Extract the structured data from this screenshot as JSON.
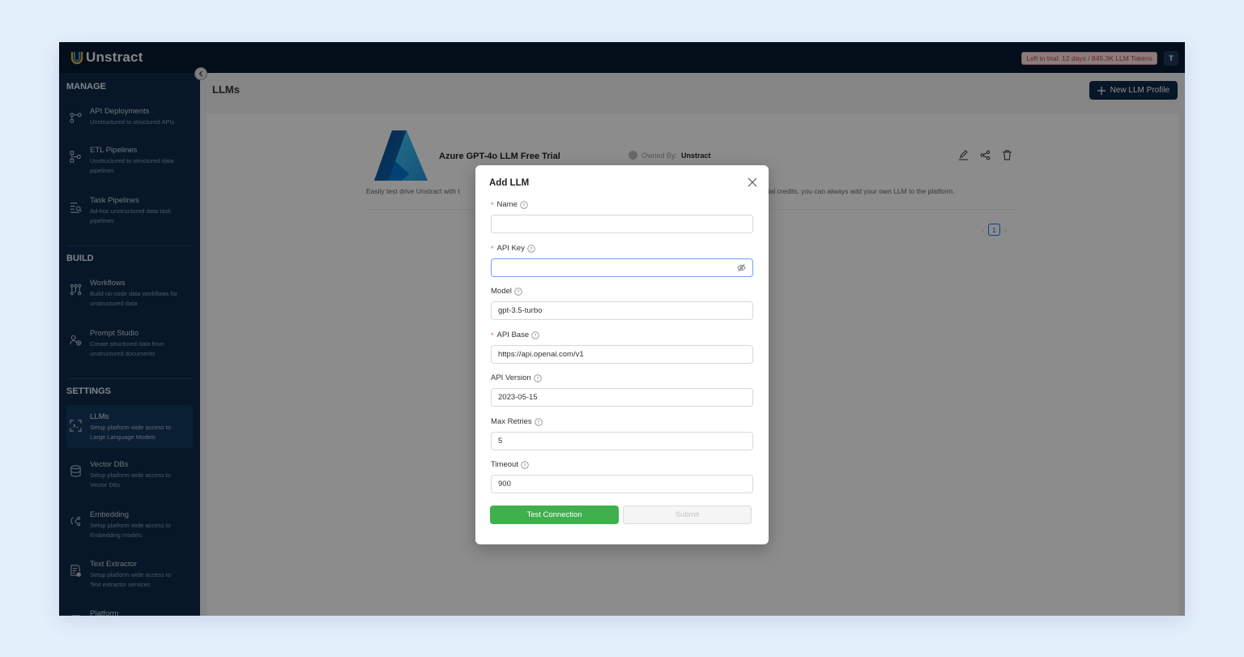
{
  "app": {
    "name": "Unstract",
    "trial_badge": "Left in trial: 12 days / 845.3K LLM Tokens",
    "user_initial": "T"
  },
  "sidebar": {
    "sections": [
      {
        "title": "MANAGE",
        "items": [
          {
            "label": "API Deployments",
            "desc_lines": [
              "Unstructured to structured APIs"
            ],
            "icon": "api-deployment-icon"
          },
          {
            "label": "ETL Pipelines",
            "desc_lines": [
              "Unstructured to structured data",
              "pipelines"
            ],
            "icon": "etl-pipeline-icon"
          },
          {
            "label": "Task Pipelines",
            "desc_lines": [
              "Ad-hoc unstructured data task",
              "pipelines"
            ],
            "icon": "task-pipeline-icon"
          }
        ]
      },
      {
        "title": "BUILD",
        "items": [
          {
            "label": "Workflows",
            "desc_lines": [
              "Build no-code data workflows for",
              "unstructured data"
            ],
            "icon": "workflow-icon"
          },
          {
            "label": "Prompt Studio",
            "desc_lines": [
              "Create structured data from",
              "unstructured documents"
            ],
            "icon": "prompt-studio-icon"
          }
        ]
      },
      {
        "title": "SETTINGS",
        "items": [
          {
            "label": "LLMs",
            "desc_lines": [
              "Setup platform wide access to",
              "Large Language Models"
            ],
            "icon": "llm-icon",
            "active": true
          },
          {
            "label": "Vector DBs",
            "desc_lines": [
              "Setup platform wide access to",
              "Vector DBs"
            ],
            "icon": "database-icon"
          },
          {
            "label": "Embedding",
            "desc_lines": [
              "Setup platform wide access to",
              "Embedding models"
            ],
            "icon": "embedding-icon"
          },
          {
            "label": "Text Extractor",
            "desc_lines": [
              "Setup platform wide access to",
              "Text extractor services"
            ],
            "icon": "text-extractor-icon"
          },
          {
            "label": "Platform",
            "desc_lines": [],
            "icon": "platform-icon"
          }
        ]
      }
    ]
  },
  "main": {
    "title": "LLMs",
    "new_button_label": "New LLM Profile",
    "card": {
      "name": "Azure GPT-4o LLM Free Trial",
      "owned_by_label": "Owned By:",
      "owned_by_value": "Unstract",
      "description_left": "Easily test drive Unstract with t",
      "description_right": "f free trial credits, you can always add your own LLM to the platform.",
      "page_number": "1"
    }
  },
  "modal": {
    "title": "Add LLM",
    "fields": [
      {
        "label": "Name",
        "required": true,
        "value": ""
      },
      {
        "label": "API Key",
        "required": true,
        "value": "",
        "secret": true
      },
      {
        "label": "Model",
        "required": false,
        "value": "gpt-3.5-turbo"
      },
      {
        "label": "API Base",
        "required": true,
        "value": "https://api.openai.com/v1"
      },
      {
        "label": "API Version",
        "required": false,
        "value": "2023-05-15"
      },
      {
        "label": "Max Retries",
        "required": false,
        "value": "5"
      },
      {
        "label": "Timeout",
        "required": false,
        "value": "900"
      }
    ],
    "test_button": "Test Connection",
    "submit_button": "Submit"
  },
  "colors": {
    "topbar": "#071a30",
    "sidebar": "#0e2a47",
    "sidebar_active": "#143a5f",
    "test_button": "#3fb04c",
    "required_star": "#ff4d4f",
    "azure_blue": "#0f6cbd"
  }
}
